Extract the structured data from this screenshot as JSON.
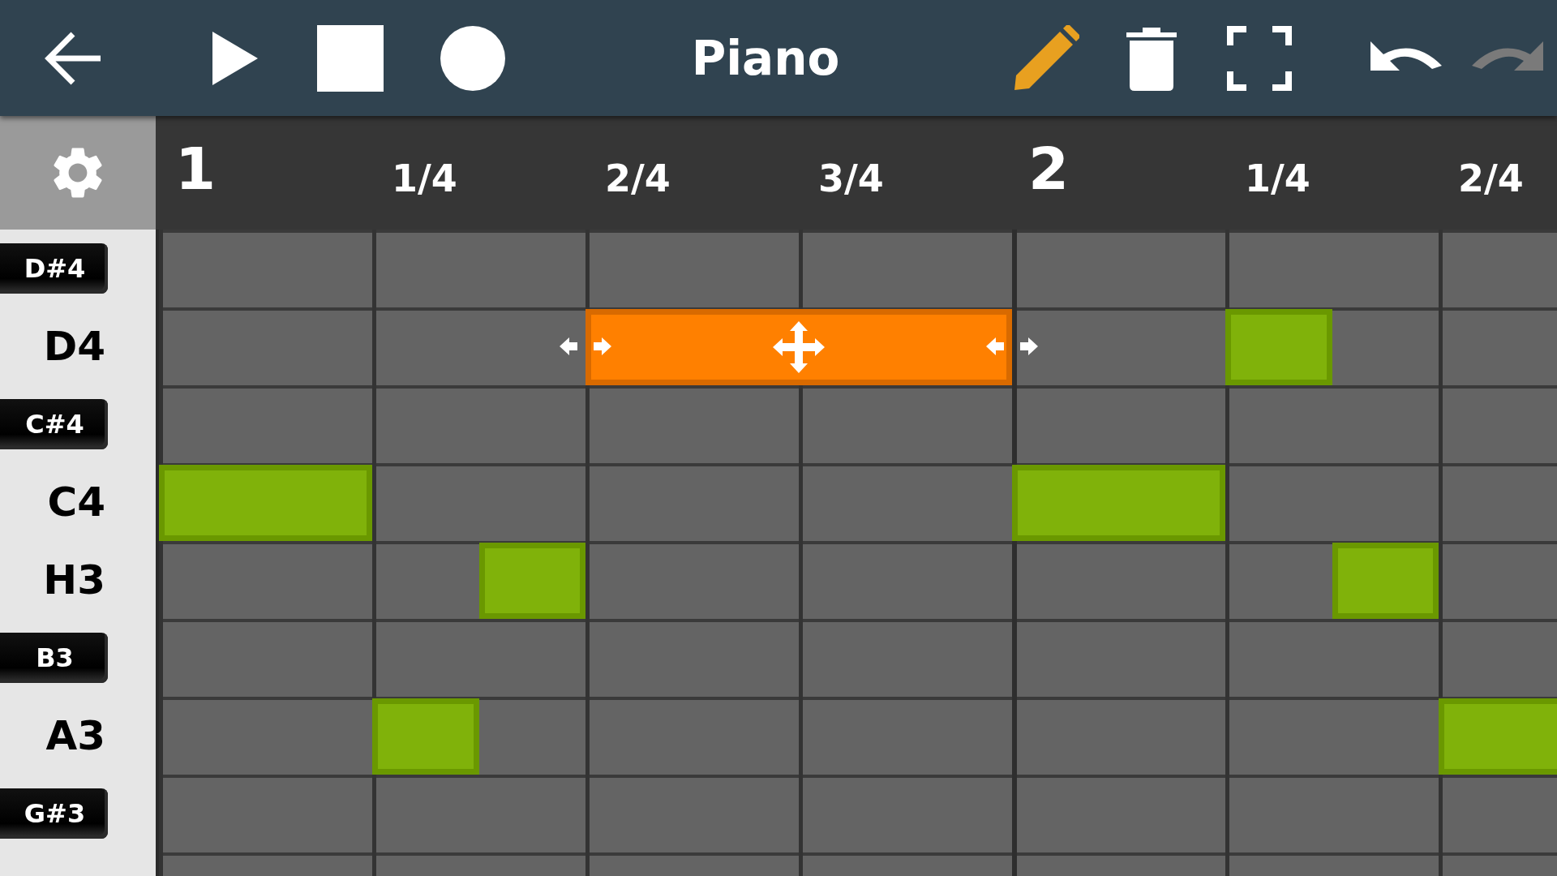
{
  "toolbar": {
    "title": "Piano",
    "pencil_active": true,
    "undo_disabled": false,
    "redo_disabled": true
  },
  "ruler": [
    {
      "kind": "bar",
      "text": "1"
    },
    {
      "kind": "beat",
      "text": "1/4"
    },
    {
      "kind": "beat",
      "text": "2/4"
    },
    {
      "kind": "beat",
      "text": "3/4"
    },
    {
      "kind": "bar",
      "text": "2"
    },
    {
      "kind": "beat",
      "text": "1/4"
    },
    {
      "kind": "beat",
      "text": "2/4"
    }
  ],
  "keys": [
    {
      "kind": "black",
      "label": "D#4"
    },
    {
      "kind": "white",
      "label": "D4",
      "notes": [
        {
          "selected": true
        },
        {
          "selected": false
        }
      ]
    },
    {
      "kind": "black",
      "label": "C#4"
    },
    {
      "kind": "white",
      "label": "C4",
      "notes": [
        {
          "selected": false
        },
        {
          "selected": false
        }
      ]
    },
    {
      "kind": "white",
      "label": "H3",
      "notes": [
        {
          "selected": false
        },
        {
          "selected": false
        }
      ]
    },
    {
      "kind": "black",
      "label": "B3"
    },
    {
      "kind": "white",
      "label": "A3",
      "notes": [
        {
          "selected": false
        },
        {
          "selected": false
        }
      ]
    },
    {
      "kind": "black",
      "label": "G#3"
    }
  ]
}
